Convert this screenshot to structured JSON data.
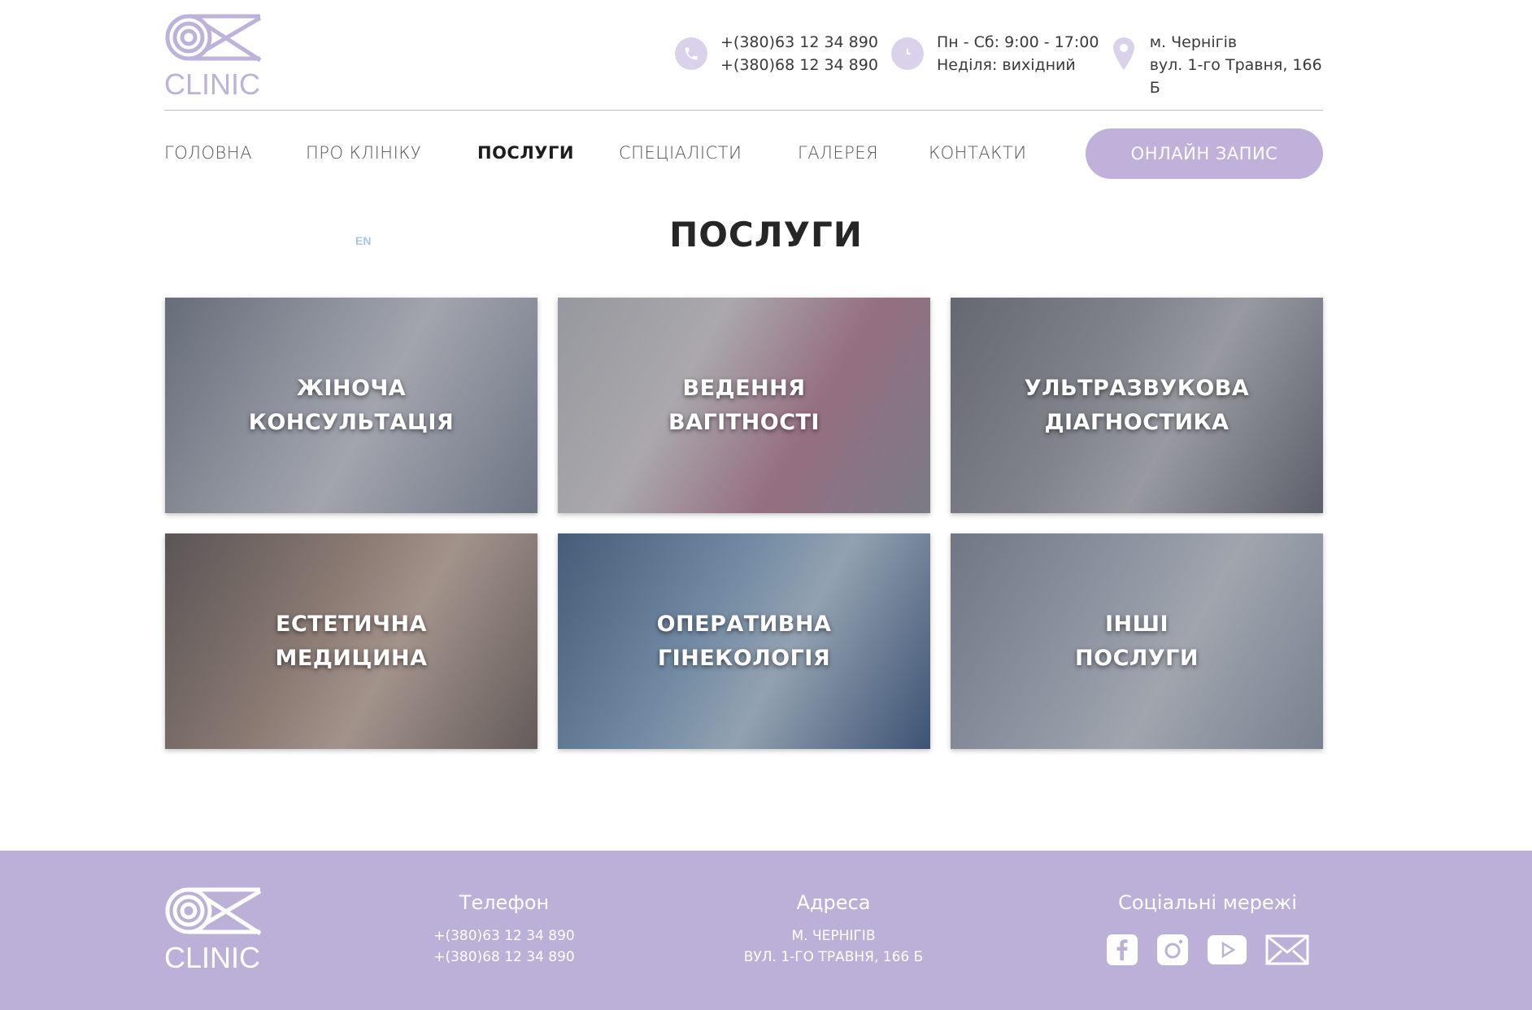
{
  "brand": {
    "logo_text": "CLINIC",
    "accent_color": "#bcb0d8"
  },
  "header": {
    "phone": {
      "icon": "phone-icon",
      "line1": "+(380)63 12 34 890",
      "line2": "+(380)68 12 34 890"
    },
    "hours": {
      "icon": "clock-icon",
      "line1": "Пн - Сб: 9:00 - 17:00",
      "line2": "Неділя: вихідний"
    },
    "address": {
      "icon": "map-pin-icon",
      "line1": "м. Чернігів",
      "line2": "вул. 1-го Травня, 166 Б"
    }
  },
  "nav": {
    "items": [
      "ГОЛОВНА",
      "ПРО КЛІНІКУ",
      "ПОСЛУГИ",
      "СПЕЦІАЛІСТИ",
      "ГАЛЕРЕЯ",
      "КОНТАКТИ"
    ],
    "active": "ПОСЛУГИ",
    "cta": "ОНЛАЙН ЗАПИС"
  },
  "lang": "EN",
  "page_title": "ПОСЛУГИ",
  "services": [
    {
      "line1": "ЖІНОЧА",
      "line2": "КОНСУЛЬТАЦІЯ"
    },
    {
      "line1": "ВЕДЕННЯ",
      "line2": "ВАГІТНОСТІ"
    },
    {
      "line1": "УЛЬТРАЗВУКОВА",
      "line2": "ДІАГНОСТИКА"
    },
    {
      "line1": "ЕСТЕТИЧНА",
      "line2": "МЕДИЦИНА"
    },
    {
      "line1": "ОПЕРАТИВНА",
      "line2": "ГІНЕКОЛОГІЯ"
    },
    {
      "line1": "ІНШІ",
      "line2": "ПОСЛУГИ"
    }
  ],
  "footer": {
    "phone_heading": "Телефон",
    "phone1": "+(380)63 12 34 890",
    "phone2": "+(380)68 12 34 890",
    "address_heading": "Адреса",
    "address1": "м. Чернігів",
    "address2": "вул. 1-го Травня, 166 Б",
    "social_heading": "Соціальні мережі",
    "socials": [
      "facebook-icon",
      "instagram-icon",
      "youtube-icon",
      "mail-icon"
    ]
  }
}
